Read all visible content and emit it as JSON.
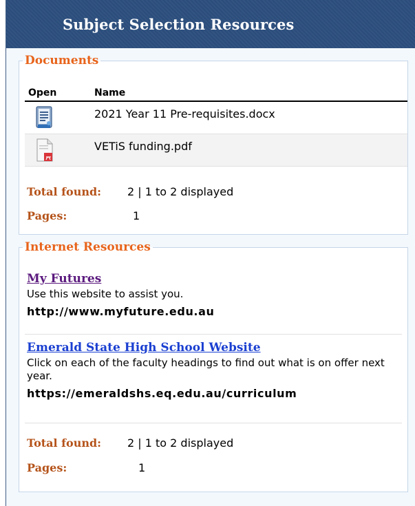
{
  "panel": {
    "title": "Subject Selection Resources"
  },
  "documents": {
    "legend": "Documents",
    "columns": {
      "open": "Open",
      "name": "Name"
    },
    "rows": [
      {
        "icon": "word-document-icon",
        "name": "2021 Year 11 Pre-requisites.docx"
      },
      {
        "icon": "pdf-document-icon",
        "name": "VETiS funding.pdf"
      }
    ],
    "total_label": "Total found:",
    "total_value": "2 | 1 to 2 displayed",
    "pages_label": "Pages:",
    "pages_value": "1"
  },
  "internet": {
    "legend": "Internet Resources",
    "items": [
      {
        "title": "My Futures",
        "description": "Use this website to assist you.",
        "url": "http://www.myfuture.edu.au"
      },
      {
        "title": "Emerald State High School Website",
        "description": "Click on each of the faculty headings to find out what is on offer next year.",
        "url": "https://emeraldshs.eq.edu.au/curriculum"
      }
    ],
    "total_label": "Total found:",
    "total_value": "2 | 1 to 2 displayed",
    "pages_label": "Pages:",
    "pages_value": "1"
  },
  "colors": {
    "header": "#2b4d7c",
    "legend": "#e8641b",
    "stat_label": "#b5531a",
    "visited_link": "#5b1a7e",
    "link": "#1a3fd1"
  }
}
